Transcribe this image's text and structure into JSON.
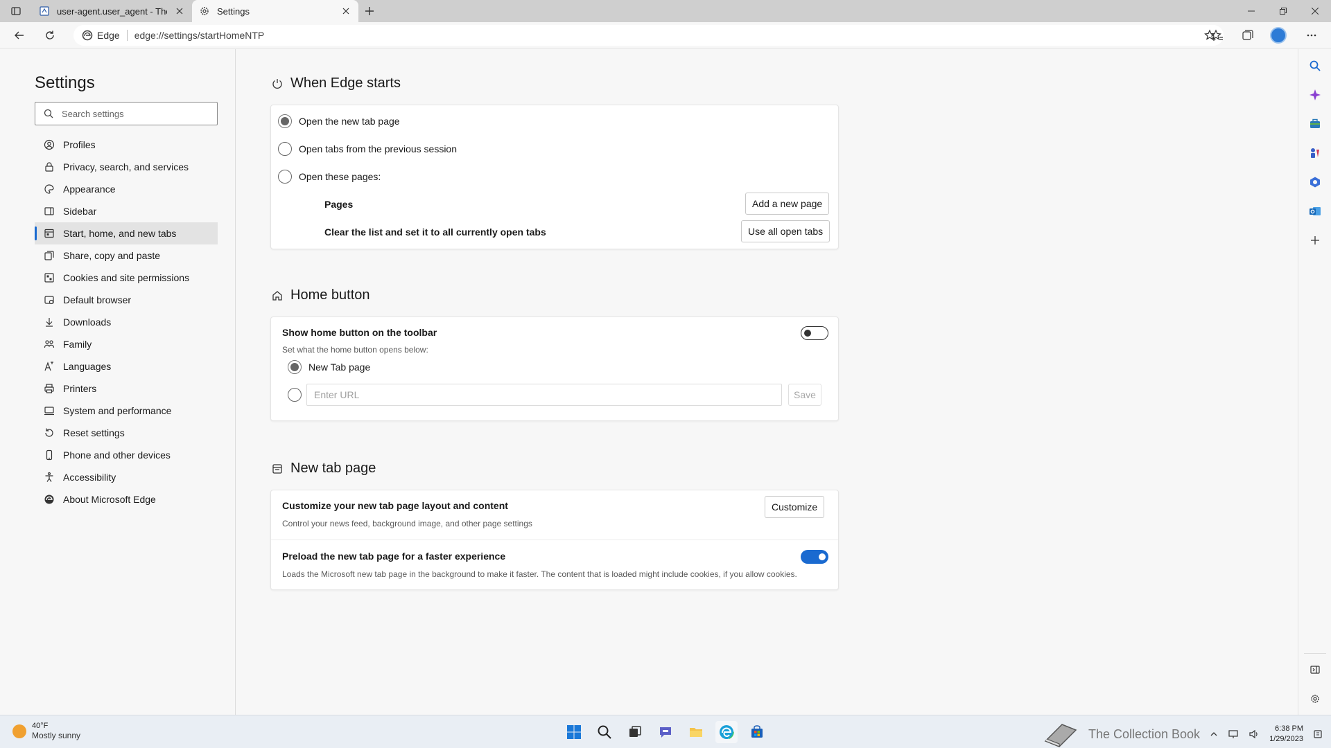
{
  "browser": {
    "tabs": [
      {
        "title": "user-agent.user_agent - The Coll",
        "icon": "page-icon"
      },
      {
        "title": "Settings",
        "icon": "gear-icon"
      }
    ],
    "address": {
      "site_label": "Edge",
      "url": "edge://settings/startHomeNTP"
    }
  },
  "settings_nav": {
    "title": "Settings",
    "search_placeholder": "Search settings",
    "items": [
      {
        "label": "Profiles",
        "icon": "profile-icon"
      },
      {
        "label": "Privacy, search, and services",
        "icon": "lock-icon"
      },
      {
        "label": "Appearance",
        "icon": "appearance-icon"
      },
      {
        "label": "Sidebar",
        "icon": "sidebar-icon"
      },
      {
        "label": "Start, home, and new tabs",
        "icon": "start-icon",
        "selected": true
      },
      {
        "label": "Share, copy and paste",
        "icon": "share-icon"
      },
      {
        "label": "Cookies and site permissions",
        "icon": "cookies-icon"
      },
      {
        "label": "Default browser",
        "icon": "browser-icon"
      },
      {
        "label": "Downloads",
        "icon": "download-icon"
      },
      {
        "label": "Family",
        "icon": "family-icon"
      },
      {
        "label": "Languages",
        "icon": "language-icon"
      },
      {
        "label": "Printers",
        "icon": "printer-icon"
      },
      {
        "label": "System and performance",
        "icon": "system-icon"
      },
      {
        "label": "Reset settings",
        "icon": "reset-icon"
      },
      {
        "label": "Phone and other devices",
        "icon": "phone-icon"
      },
      {
        "label": "Accessibility",
        "icon": "accessibility-icon"
      },
      {
        "label": "About Microsoft Edge",
        "icon": "edge-icon"
      }
    ]
  },
  "when_edge_starts": {
    "title": "When Edge starts",
    "options": [
      {
        "label": "Open the new tab page",
        "checked": true
      },
      {
        "label": "Open tabs from the previous session",
        "checked": false
      },
      {
        "label": "Open these pages:",
        "checked": false
      }
    ],
    "pages_label": "Pages",
    "add_page_button": "Add a new page",
    "clear_list_label": "Clear the list and set it to all currently open tabs",
    "use_open_tabs_button": "Use all open tabs"
  },
  "home_button": {
    "title": "Home button",
    "show_label": "Show home button on the toolbar",
    "show_toggle": false,
    "sub_label": "Set what the home button opens below:",
    "new_tab_option": "New Tab page",
    "new_tab_checked": true,
    "url_placeholder": "Enter URL",
    "save_button": "Save"
  },
  "new_tab_page": {
    "title": "New tab page",
    "customize_label": "Customize your new tab page layout and content",
    "customize_button": "Customize",
    "customize_sub": "Control your news feed, background image, and other page settings",
    "preload_label": "Preload the new tab page for a faster experience",
    "preload_toggle": true,
    "preload_sub": "Loads the Microsoft new tab page in the background to make it faster. The content that is loaded might include cookies, if you allow cookies."
  },
  "taskbar": {
    "weather_temp": "40°F",
    "weather_desc": "Mostly sunny",
    "time": "6:38 PM",
    "date": "1/29/2023",
    "watermark": "The Collection Book"
  },
  "colors": {
    "accent": "#1a6ad0",
    "tabbar": "#cfcfcf",
    "page_bg": "#f7f7f7"
  }
}
